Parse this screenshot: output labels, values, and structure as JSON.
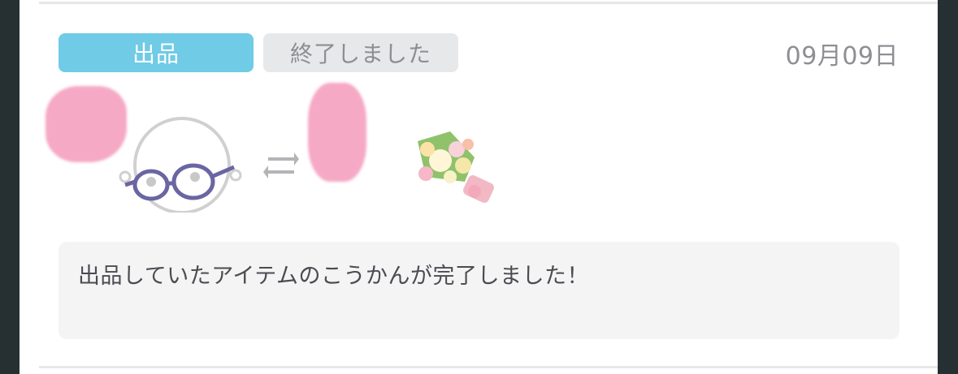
{
  "notification": {
    "type_badge": "出品",
    "status_badge": "終了しました",
    "date": "09月09日",
    "message": "出品していたアイテムのこうかんが完了しました！"
  },
  "icons": {
    "avatar": "avatar-with-glasses-icon",
    "swap": "swap-arrows-icon",
    "item": "flower-bouquet-icon"
  },
  "colors": {
    "type_badge_bg": "#6fcbe6",
    "status_badge_bg": "#e7e8ea",
    "redaction": "#f6a9c5",
    "message_box_bg": "#f4f4f5"
  }
}
